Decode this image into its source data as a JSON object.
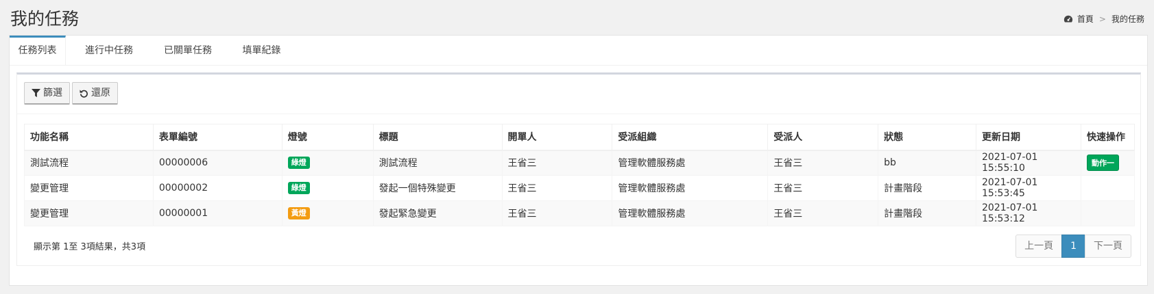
{
  "header": {
    "title": "我的任務"
  },
  "breadcrumb": {
    "home": "首頁",
    "separator": ">",
    "current": "我的任務"
  },
  "tabs": [
    {
      "label": "任務列表",
      "active": true
    },
    {
      "label": "進行中任務",
      "active": false
    },
    {
      "label": "已關單任務",
      "active": false
    },
    {
      "label": "填單紀錄",
      "active": false
    }
  ],
  "toolbar": {
    "filter_label": "篩選",
    "reset_label": "還原"
  },
  "table": {
    "columns": [
      "功能名稱",
      "表單編號",
      "燈號",
      "標題",
      "開單人",
      "受派組織",
      "受派人",
      "狀態",
      "更新日期",
      "快速操作"
    ],
    "rows": [
      [
        "測試流程",
        "00000006",
        "綠燈",
        "測試流程",
        "王省三",
        "管理軟體服務處",
        "王省三",
        "bb",
        "2021-07-01 15:55:10",
        "動作一"
      ],
      [
        "變更管理",
        "00000002",
        "綠燈",
        "發起一個特殊變更",
        "王省三",
        "管理軟體服務處",
        "王省三",
        "計畫階段",
        "2021-07-01 15:53:45",
        ""
      ],
      [
        "變更管理",
        "00000001",
        "黃燈",
        "發起緊急變更",
        "王省三",
        "管理軟體服務處",
        "王省三",
        "計畫階段",
        "2021-07-01 15:53:12",
        ""
      ]
    ]
  },
  "lamp_colors": {
    "綠燈": "#00a65a",
    "黃燈": "#f39c12"
  },
  "pagination": {
    "info": "顯示第 1至 3項結果，共3項",
    "prev": "上一頁",
    "current": "1",
    "next": "下一頁"
  }
}
